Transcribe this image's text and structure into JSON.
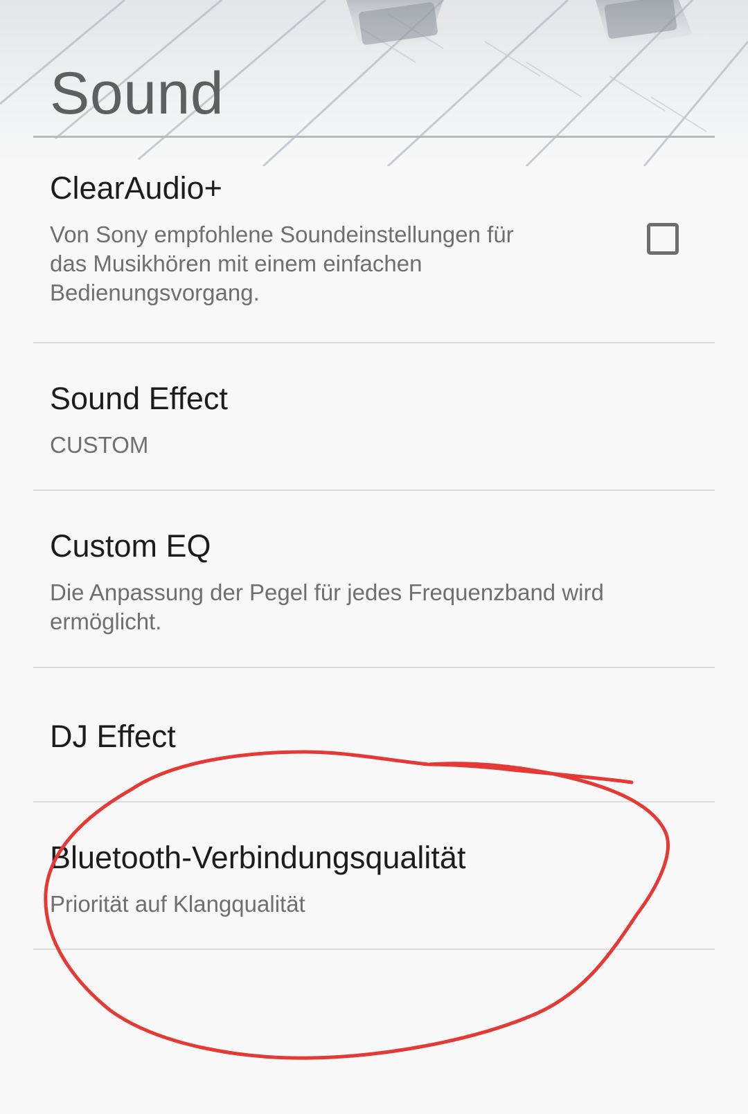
{
  "header": {
    "title": "Sound"
  },
  "preferences": [
    {
      "title": "ClearAudio+",
      "summary": "Von Sony empfohlene Soundeinstellungen für das Musikhören mit einem einfachen Bedienungsvorgang.",
      "checked": false
    },
    {
      "title": "Sound Effect",
      "summary": "CUSTOM"
    },
    {
      "title": "Custom EQ",
      "summary": "Die Anpassung der Pegel für jedes Frequenzband wird ermöglicht."
    },
    {
      "title": "DJ Effect"
    },
    {
      "title": "Bluetooth-Verbindungsqualität",
      "summary": "Priorität auf Klangqualität"
    }
  ],
  "colors": {
    "background": "#f8f8f8",
    "title_text": "#5f5f5f",
    "item_title": "#1c1c1c",
    "item_summary": "#6f6f6f",
    "annotation_stroke": "#e53935"
  },
  "icons": {
    "clearaudio_checkbox": "checkbox-unchecked-icon",
    "header_background": "mixer-faders-icon"
  }
}
